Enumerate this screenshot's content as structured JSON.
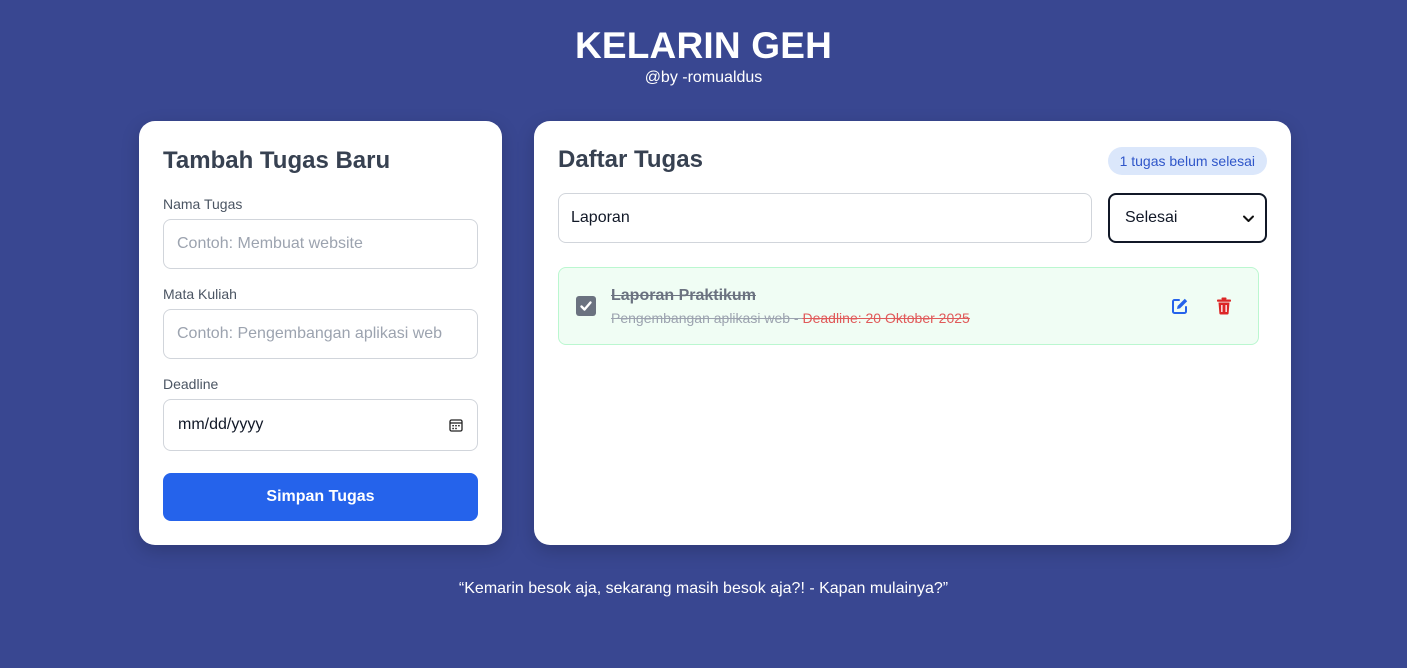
{
  "header": {
    "title": "KELARIN GEH",
    "subtitle": "@by -romualdus"
  },
  "form": {
    "title": "Tambah Tugas Baru",
    "task_name_label": "Nama Tugas",
    "task_name_placeholder": "Contoh: Membuat website",
    "course_label": "Mata Kuliah",
    "course_placeholder": "Contoh: Pengembangan aplikasi web",
    "deadline_label": "Deadline",
    "deadline_placeholder": "mm/dd/yyyy",
    "save_label": "Simpan Tugas"
  },
  "list": {
    "title": "Daftar Tugas",
    "badge": "1 tugas belum selesai",
    "search_value": "Laporan",
    "filter_selected": "Selesai",
    "tasks": [
      {
        "title": "Laporan Praktikum",
        "course": "Pengembangan aplikasi web",
        "separator": " - ",
        "deadline": "Deadline: 20 Oktober 2025",
        "done": true
      }
    ]
  },
  "footer": {
    "quote": "“Kemarin besok aja, sekarang masih besok aja?! - Kapan mulainya?”"
  },
  "colors": {
    "background": "#394791",
    "primary": "#2563eb",
    "danger": "#dc2626",
    "done_bg": "#f0fdf4"
  },
  "icons": [
    "calendar-icon",
    "chevron-down-icon",
    "check-icon",
    "edit-icon",
    "trash-icon"
  ]
}
